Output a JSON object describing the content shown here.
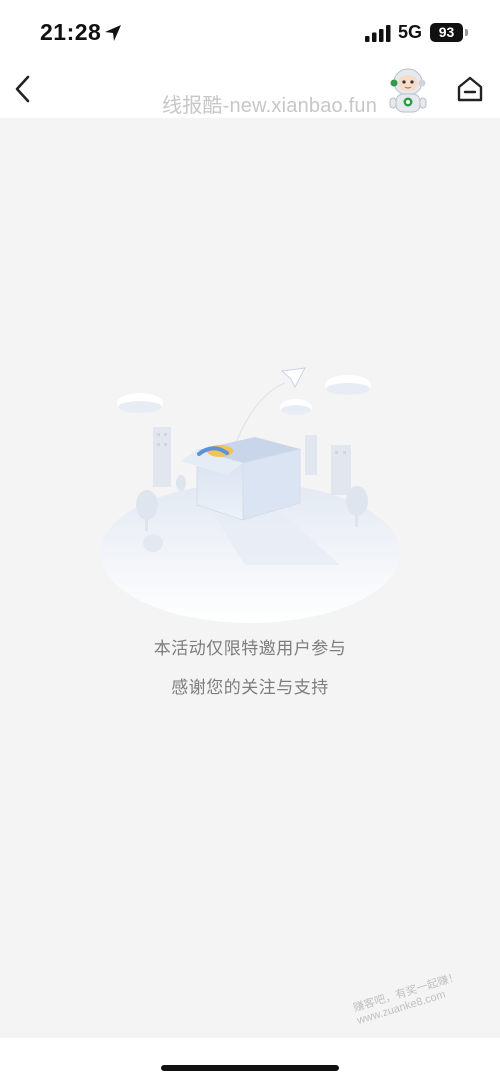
{
  "status_bar": {
    "time": "21:28",
    "network": "5G",
    "battery": "93"
  },
  "nav": {
    "watermark": "线报酷-new.xianbao.fun"
  },
  "main": {
    "message_line1": "本活动仅限特邀用户参与",
    "message_line2": "感谢您的关注与支持"
  },
  "overlay": {
    "corner_watermark_line1": "赚客吧，有奖一起赚！",
    "corner_watermark_line2": "www.zuanke8.com"
  },
  "colors": {
    "page_bg": "#f4f4f4",
    "header_bg": "#ffffff",
    "message_text": "#7d7d7d",
    "illustration_blue": "#cfdcef",
    "mascot_green": "#2e9a4a"
  },
  "icons": [
    "location-arrow-icon",
    "signal-icon",
    "back-arrow-icon",
    "robot-mascot-icon",
    "home-icon",
    "empty-state-illustration"
  ]
}
